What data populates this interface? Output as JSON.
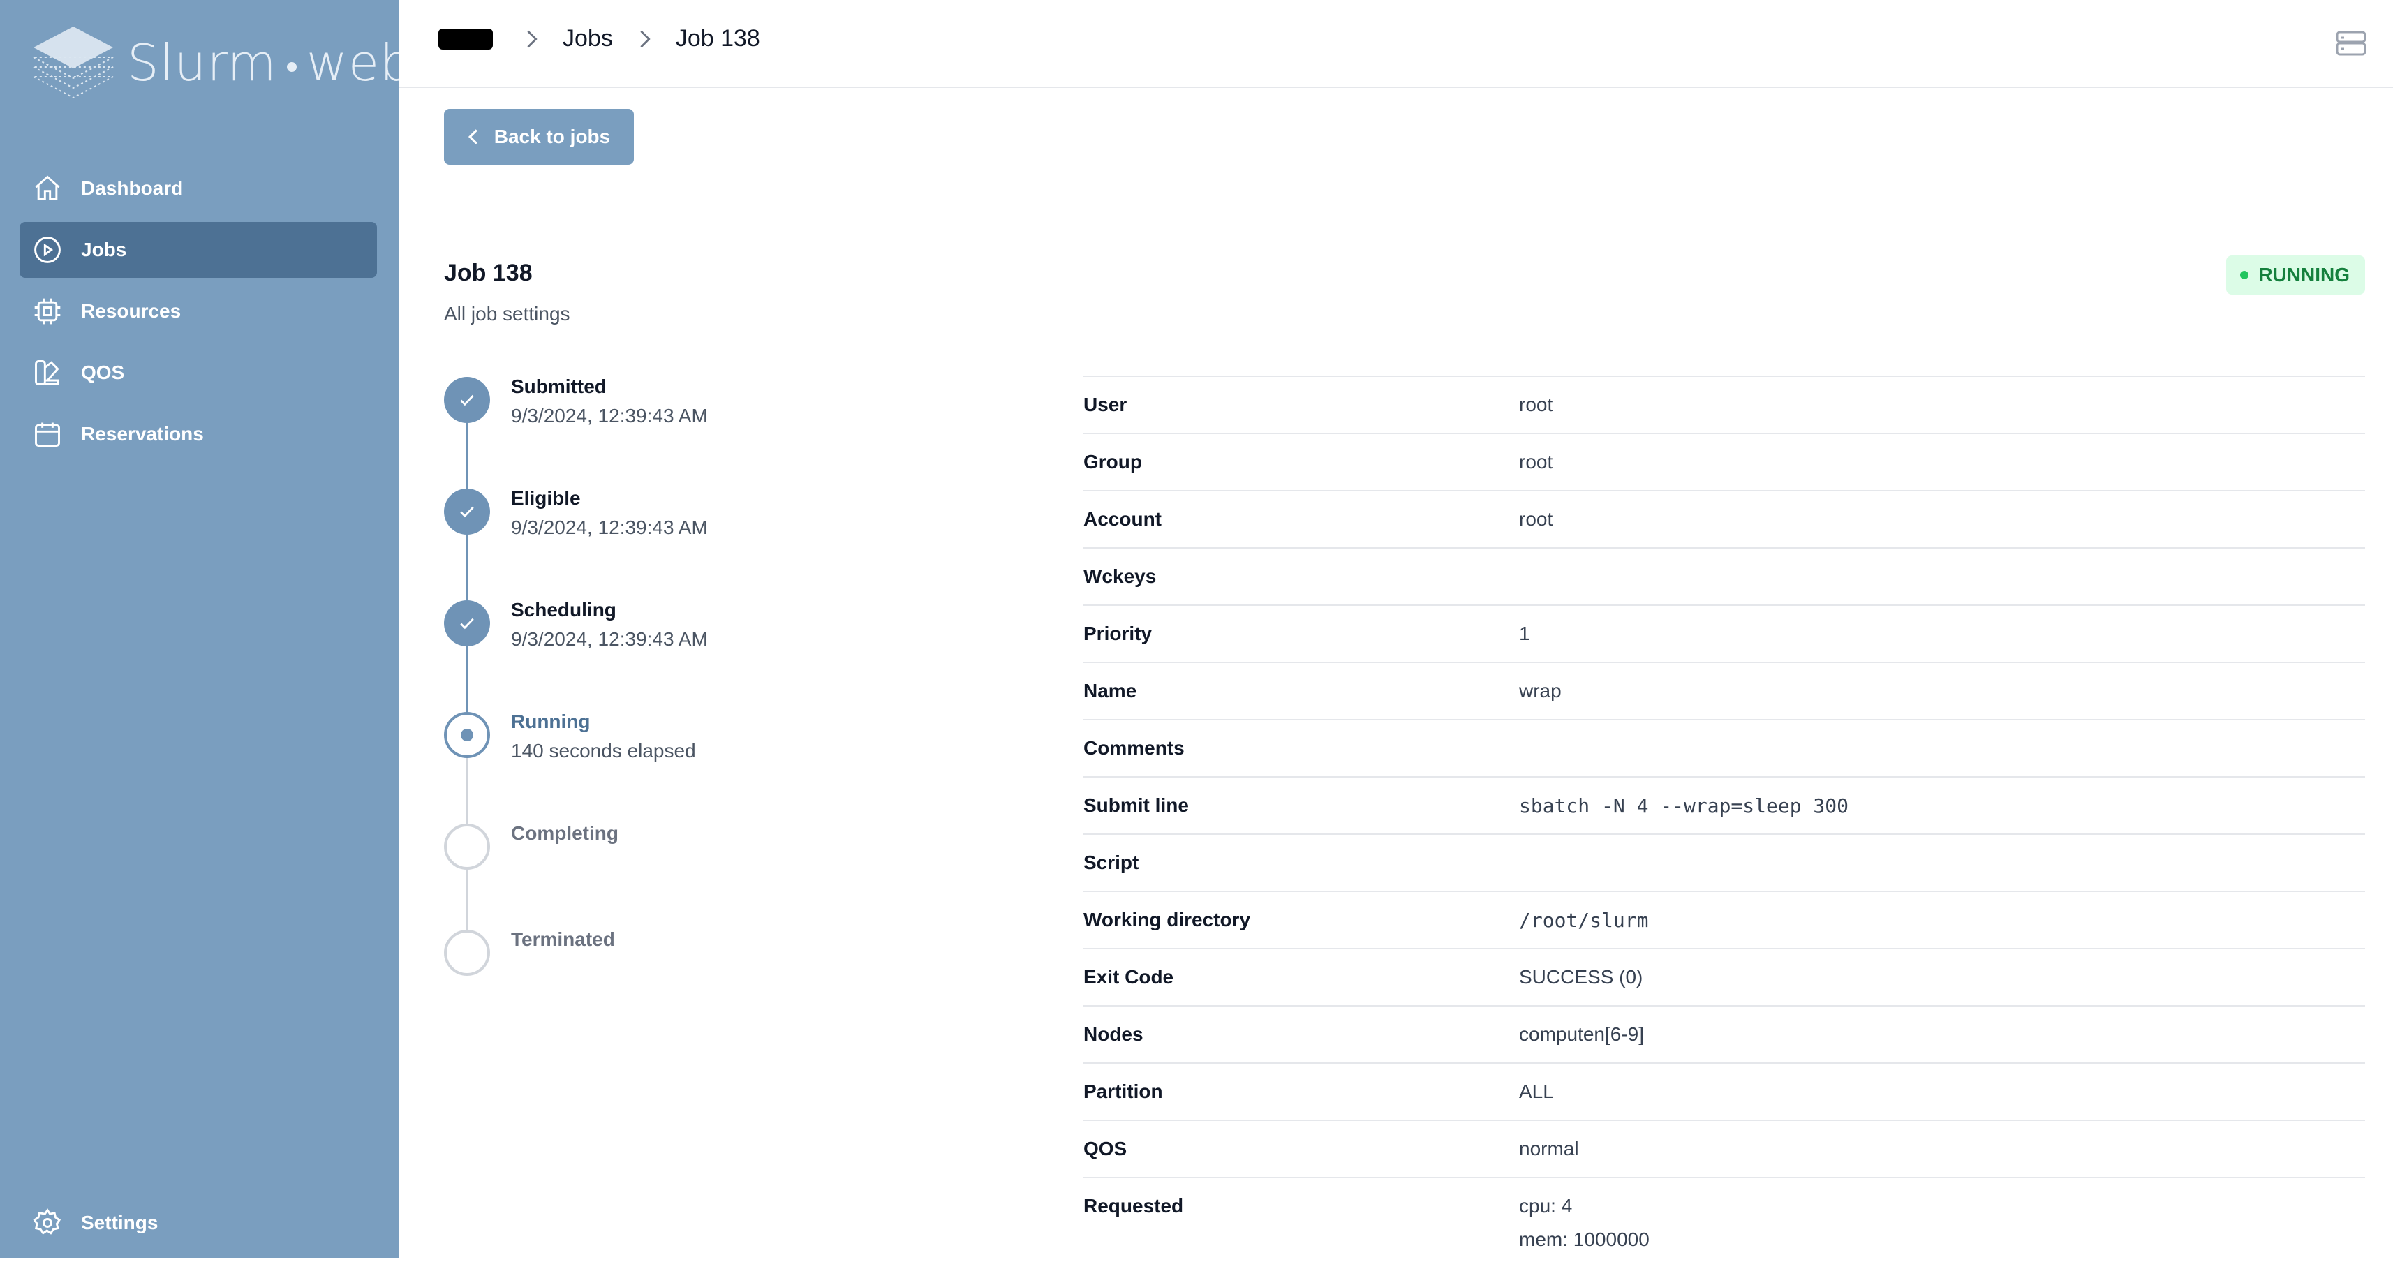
{
  "app": {
    "name_part1": "Slurm",
    "name_part2": "web"
  },
  "sidebar": {
    "items": [
      {
        "label": "Dashboard",
        "icon": "home-icon",
        "active": false
      },
      {
        "label": "Jobs",
        "icon": "play-circle-icon",
        "active": true
      },
      {
        "label": "Resources",
        "icon": "cpu-chip-icon",
        "active": false
      },
      {
        "label": "QOS",
        "icon": "swatch-icon",
        "active": false
      },
      {
        "label": "Reservations",
        "icon": "calendar-icon",
        "active": false
      }
    ],
    "settings_label": "Settings"
  },
  "breadcrumb": {
    "root_redacted": true,
    "items": [
      "Jobs",
      "Job 138"
    ]
  },
  "back_button_label": "Back to jobs",
  "job": {
    "title": "Job 138",
    "subtitle": "All job settings",
    "status": "RUNNING"
  },
  "timeline": [
    {
      "label": "Submitted",
      "sub": "9/3/2024, 12:39:43 AM",
      "state": "done"
    },
    {
      "label": "Eligible",
      "sub": "9/3/2024, 12:39:43 AM",
      "state": "done"
    },
    {
      "label": "Scheduling",
      "sub": "9/3/2024, 12:39:43 AM",
      "state": "done"
    },
    {
      "label": "Running",
      "sub": "140 seconds elapsed",
      "state": "current"
    },
    {
      "label": "Completing",
      "sub": "",
      "state": "todo"
    },
    {
      "label": "Terminated",
      "sub": "",
      "state": "todo"
    }
  ],
  "details": [
    {
      "key": "User",
      "value": "root"
    },
    {
      "key": "Group",
      "value": "root"
    },
    {
      "key": "Account",
      "value": "root"
    },
    {
      "key": "Wckeys",
      "value": ""
    },
    {
      "key": "Priority",
      "value": "1"
    },
    {
      "key": "Name",
      "value": "wrap"
    },
    {
      "key": "Comments",
      "value": ""
    },
    {
      "key": "Submit line",
      "value": "sbatch -N 4 --wrap=sleep 300",
      "mono": true
    },
    {
      "key": "Script",
      "value": ""
    },
    {
      "key": "Working directory",
      "value": "/root/slurm",
      "mono": true
    },
    {
      "key": "Exit Code",
      "value": "SUCCESS (0)"
    },
    {
      "key": "Nodes",
      "value": "computen[6-9]"
    },
    {
      "key": "Partition",
      "value": "ALL"
    },
    {
      "key": "QOS",
      "value": "normal"
    },
    {
      "key": "Requested",
      "value": "cpu: 4",
      "value2": "mem: 1000000"
    }
  ],
  "colors": {
    "sidebar_bg": "#7a9ebf",
    "sidebar_active": "#4d7194",
    "accent": "#6f93b6",
    "status_bg": "#dcfce7",
    "status_text": "#15803d"
  }
}
